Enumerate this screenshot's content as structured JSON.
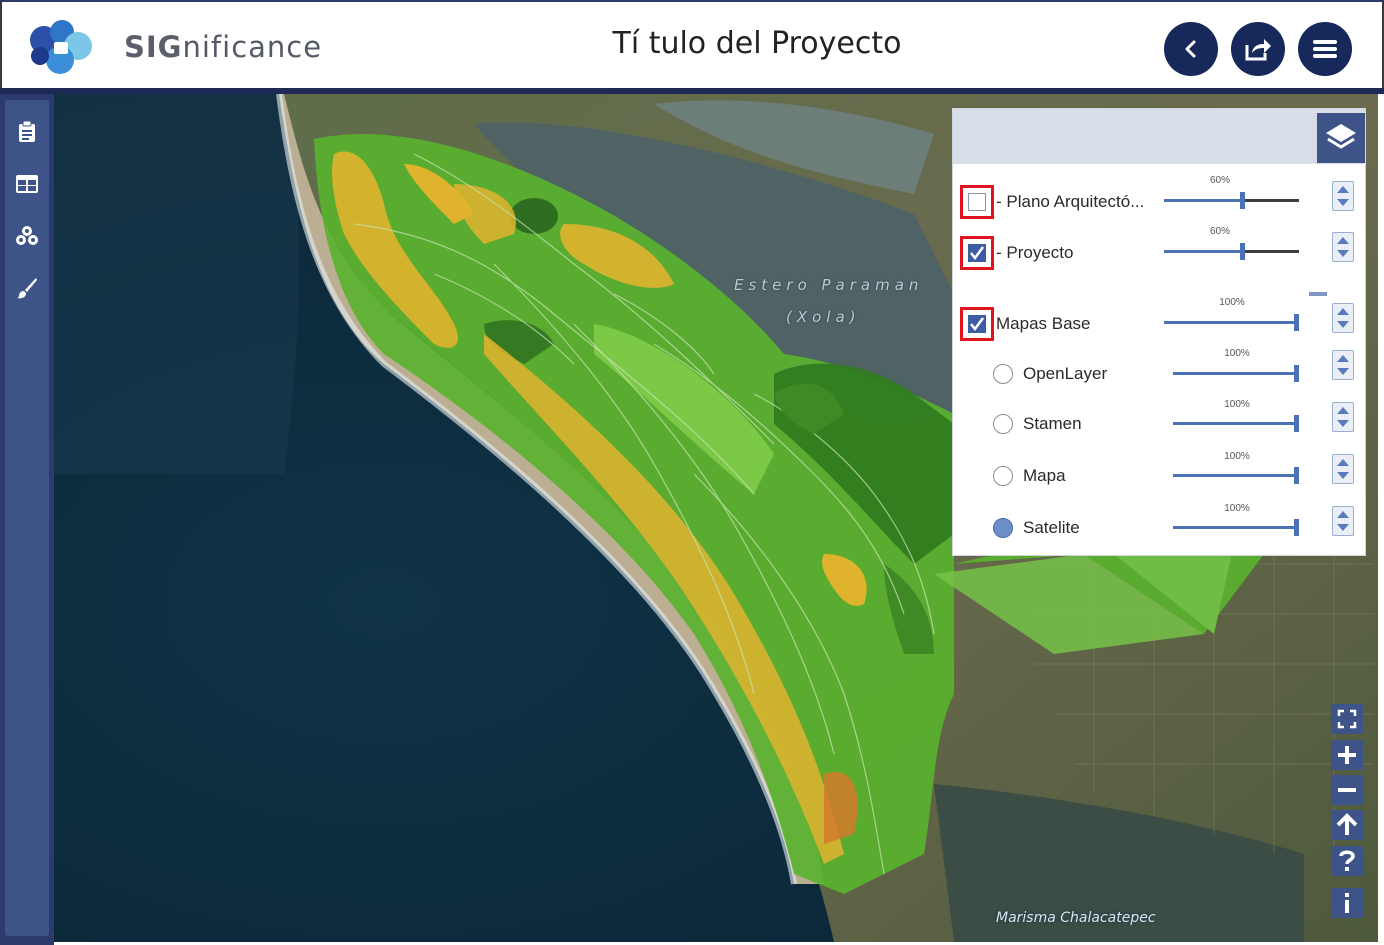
{
  "header": {
    "brand_bold": "SIG",
    "brand_rest": "nificance",
    "title": "Tí tulo del Proyecto"
  },
  "header_buttons": [
    "back-icon",
    "share-icon",
    "menu-icon"
  ],
  "sidebar_icons": [
    "clipboard-icon",
    "table-icon",
    "layers-cubes-icon",
    "paintbrush-icon"
  ],
  "map": {
    "label_estero_1": "Estero Paraman",
    "label_estero_2": "(Xola)",
    "label_marisma": "Marisma Chalacatepec"
  },
  "layers": [
    {
      "label": "- Plano Arquitectó...",
      "checked": false,
      "opacity_label": "60%",
      "opacity": 0.6
    },
    {
      "label": "- Proyecto",
      "checked": true,
      "opacity_label": "60%",
      "opacity": 0.6
    },
    {
      "label": "Mapas Base",
      "checked": true,
      "opacity_label": "100%",
      "opacity": 1.0
    }
  ],
  "basemaps": [
    {
      "label": "OpenLayer",
      "selected": false,
      "opacity_label": "100%",
      "opacity": 1.0
    },
    {
      "label": "Stamen",
      "selected": false,
      "opacity_label": "100%",
      "opacity": 1.0
    },
    {
      "label": "Mapa",
      "selected": false,
      "opacity_label": "100%",
      "opacity": 1.0
    },
    {
      "label": "Satelite",
      "selected": true,
      "opacity_label": "100%",
      "opacity": 1.0
    }
  ],
  "map_controls": [
    "fullscreen-icon",
    "zoom-in-icon",
    "zoom-out-icon",
    "north-arrow-icon",
    "help-icon",
    "info-icon"
  ],
  "colors": {
    "brand_navy": "#17285a",
    "sidebar": "#3e5488",
    "highlight_red": "#e0141e",
    "slider_blue": "#4b72b5"
  }
}
